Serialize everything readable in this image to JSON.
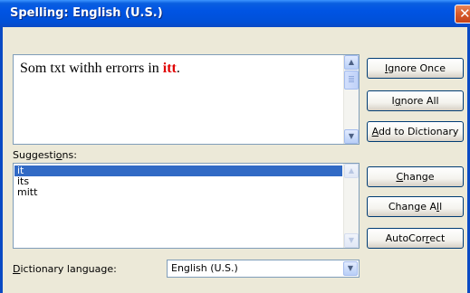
{
  "window": {
    "title": "Spelling: English (U.S.)",
    "close_glyph": "✕"
  },
  "not_in_dictionary": {
    "text_before": "Som txt withh errorrs in ",
    "error_word": "itt",
    "text_after": ".",
    "error_color": "#e00000"
  },
  "suggestions": {
    "label_pre": "Suggesti",
    "label_acc": "o",
    "label_post": "ns:",
    "items": [
      "it",
      "its",
      "mitt"
    ],
    "selected_index": 0
  },
  "buttons": {
    "ignore_once": {
      "pre": "",
      "acc": "I",
      "post": "gnore Once"
    },
    "ignore_all": {
      "pre": "I",
      "acc": "g",
      "post": "nore All"
    },
    "add_to_dictionary": {
      "pre": "",
      "acc": "A",
      "post": "dd to Dictionary"
    },
    "change": {
      "pre": "",
      "acc": "C",
      "post": "hange"
    },
    "change_all": {
      "pre": "Change A",
      "acc": "l",
      "post": "l"
    },
    "autocorrect": {
      "pre": "AutoCor",
      "acc": "r",
      "post": "ect"
    }
  },
  "dictionary_language": {
    "label_pre": "",
    "label_acc": "D",
    "label_post": "ictionary language:",
    "value": "English (U.S.)"
  },
  "icons": {
    "scroll_up": "▲",
    "scroll_down": "▼",
    "dropdown": "▼"
  },
  "colors": {
    "title_bar": "#0054e3",
    "selection": "#316ac5",
    "dialog_bg": "#ece9d8"
  }
}
